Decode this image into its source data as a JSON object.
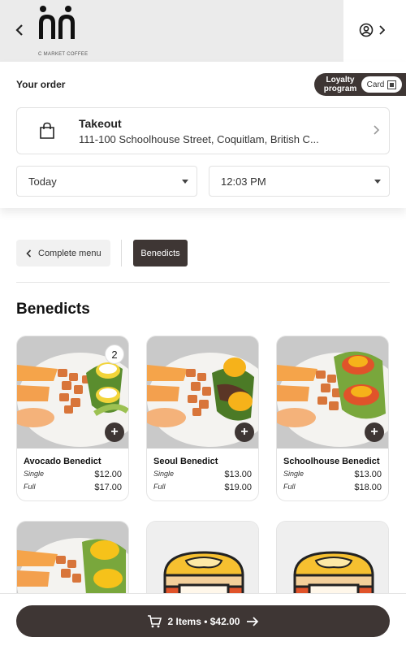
{
  "header": {
    "back_icon": "chevron-left-icon",
    "logo_text": "C MARKET COFFEE",
    "account_icon": "user-circle-icon",
    "account_chevron": "chevron-right-icon"
  },
  "order": {
    "label": "Your order",
    "loyalty_label": "Loyalty program",
    "card_label": "Card",
    "mode_title": "Takeout",
    "address": "111-100 Schoolhouse Street, Coquitlam, British C...",
    "date_value": "Today",
    "time_value": "12:03 PM"
  },
  "nav": {
    "complete_menu_label": "Complete menu",
    "active_category": "Benedicts"
  },
  "section": {
    "title": "Benedicts"
  },
  "items": [
    {
      "name": "Avocado Benedict",
      "quantity": "2",
      "prices": [
        {
          "size": "Single",
          "price": "$12.00"
        },
        {
          "size": "Full",
          "price": "$17.00"
        }
      ]
    },
    {
      "name": "Seoul Benedict",
      "prices": [
        {
          "size": "Single",
          "price": "$13.00"
        },
        {
          "size": "Full",
          "price": "$19.00"
        }
      ]
    },
    {
      "name": "Schoolhouse Benedict",
      "prices": [
        {
          "size": "Single",
          "price": "$13.00"
        },
        {
          "size": "Full",
          "price": "$18.00"
        }
      ]
    }
  ],
  "footer": {
    "cart_summary": "2 Items • $42.00"
  },
  "colors": {
    "brand_dark": "#3e3634",
    "header_bg": "#ebebeb"
  }
}
